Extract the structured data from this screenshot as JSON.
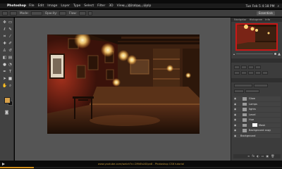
{
  "menubar": {
    "app_name": "Photoshop",
    "items": [
      "File",
      "Edit",
      "Image",
      "Layer",
      "Type",
      "Select",
      "Filter",
      "3D",
      "View",
      "Window",
      "Help"
    ],
    "window_title": "Adobe Photoshop",
    "clock": "Tue Feb 5  4:18 PM"
  },
  "options": {
    "mode_label": "Mode:",
    "opacity_label": "Opacity:",
    "flow_label": "Flow:",
    "workspace": "Essentials"
  },
  "panels": {
    "tabs": [
      "Navigator",
      "Histogram",
      "Info"
    ],
    "layers": [
      {
        "name": "Glow",
        "type": "layer",
        "selected": false
      },
      {
        "name": "Lamps",
        "type": "layer",
        "selected": false
      },
      {
        "name": "lights",
        "type": "layer",
        "selected": false
      },
      {
        "name": "Level",
        "type": "layer",
        "selected": false
      },
      {
        "name": "Hue",
        "type": "layer",
        "selected": false
      },
      {
        "name": "Mask",
        "type": "layer",
        "selected": false
      },
      {
        "name": "Background copy",
        "type": "layer",
        "selected": false
      },
      {
        "name": "Background",
        "type": "folder",
        "selected": false
      }
    ]
  },
  "bottom": {
    "url": "www.youtube.com/watch?v=2MkEsLK0pn8 - Photoshop CS6 tutorial",
    "progress_fraction": 0.12
  },
  "colors": {
    "foreground_swatch": "#d9a24a",
    "background_swatch": "#111111",
    "canvas_bg": "#555555",
    "accent_progress": "#d28f1a"
  }
}
